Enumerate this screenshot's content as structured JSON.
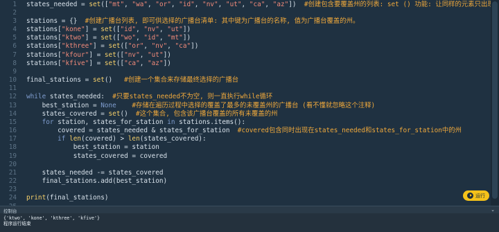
{
  "editor": {
    "lines": [
      {
        "n": "1",
        "segs": [
          [
            "pl",
            "states_needed = "
          ],
          [
            "fn",
            "set"
          ],
          [
            "pl",
            "(["
          ],
          [
            "str",
            "\"mt\""
          ],
          [
            "pl",
            ", "
          ],
          [
            "str",
            "\"wa\""
          ],
          [
            "pl",
            ", "
          ],
          [
            "str",
            "\"or\""
          ],
          [
            "pl",
            ", "
          ],
          [
            "str",
            "\"id\""
          ],
          [
            "pl",
            ", "
          ],
          [
            "str",
            "\"nv\""
          ],
          [
            "pl",
            ", "
          ],
          [
            "str",
            "\"ut\""
          ],
          [
            "pl",
            ", "
          ],
          [
            "str",
            "\"ca\""
          ],
          [
            "pl",
            ", "
          ],
          [
            "str",
            "\"az\""
          ],
          [
            "pl",
            "])  "
          ],
          [
            "cm",
            "#创建包含要覆盖州的列表: set () 功能: 让同样的元素只出现一次。"
          ]
        ]
      },
      {
        "n": "2",
        "segs": []
      },
      {
        "n": "3",
        "segs": [
          [
            "pl",
            "stations = {}  "
          ],
          [
            "cm",
            "#创建广播台列表, 即可供选择的广播台清单: 其中键为广播台的名称, 值为广播台覆盖的州。"
          ]
        ]
      },
      {
        "n": "4",
        "segs": [
          [
            "pl",
            "stations["
          ],
          [
            "str",
            "\"kone\""
          ],
          [
            "pl",
            "] = "
          ],
          [
            "fn",
            "set"
          ],
          [
            "pl",
            "(["
          ],
          [
            "str",
            "\"id\""
          ],
          [
            "pl",
            ", "
          ],
          [
            "str",
            "\"nv\""
          ],
          [
            "pl",
            ", "
          ],
          [
            "str",
            "\"ut\""
          ],
          [
            "pl",
            "])"
          ]
        ]
      },
      {
        "n": "5",
        "segs": [
          [
            "pl",
            "stations["
          ],
          [
            "str",
            "\"ktwo\""
          ],
          [
            "pl",
            "] = "
          ],
          [
            "fn",
            "set"
          ],
          [
            "pl",
            "(["
          ],
          [
            "str",
            "\"wo\""
          ],
          [
            "pl",
            ", "
          ],
          [
            "str",
            "\"id\""
          ],
          [
            "pl",
            ", "
          ],
          [
            "str",
            "\"mt\""
          ],
          [
            "pl",
            "])"
          ]
        ]
      },
      {
        "n": "6",
        "segs": [
          [
            "pl",
            "stations["
          ],
          [
            "str",
            "\"kthree\""
          ],
          [
            "pl",
            "] = "
          ],
          [
            "fn",
            "set"
          ],
          [
            "pl",
            "(["
          ],
          [
            "str",
            "\"or\""
          ],
          [
            "pl",
            ", "
          ],
          [
            "str",
            "\"nv\""
          ],
          [
            "pl",
            ", "
          ],
          [
            "str",
            "\"ca\""
          ],
          [
            "pl",
            "])"
          ]
        ]
      },
      {
        "n": "7",
        "segs": [
          [
            "pl",
            "stations["
          ],
          [
            "str",
            "\"kfour\""
          ],
          [
            "pl",
            "] = "
          ],
          [
            "fn",
            "set"
          ],
          [
            "pl",
            "(["
          ],
          [
            "str",
            "\"nv\""
          ],
          [
            "pl",
            ", "
          ],
          [
            "str",
            "\"ut\""
          ],
          [
            "pl",
            "])"
          ]
        ]
      },
      {
        "n": "8",
        "segs": [
          [
            "pl",
            "stations["
          ],
          [
            "str",
            "\"kfive\""
          ],
          [
            "pl",
            "] = "
          ],
          [
            "fn",
            "set"
          ],
          [
            "pl",
            "(["
          ],
          [
            "str",
            "\"ca\""
          ],
          [
            "pl",
            ", "
          ],
          [
            "str",
            "\"az\""
          ],
          [
            "pl",
            "])"
          ]
        ]
      },
      {
        "n": "9",
        "segs": []
      },
      {
        "n": "10",
        "segs": [
          [
            "pl",
            "final_stations = "
          ],
          [
            "fn",
            "set"
          ],
          [
            "pl",
            "()   "
          ],
          [
            "cm",
            "#创建一个集合来存储最终选择的广播台"
          ]
        ]
      },
      {
        "n": "11",
        "segs": []
      },
      {
        "n": "12",
        "segs": [
          [
            "kw",
            "while"
          ],
          [
            "pl",
            " states_needed:  "
          ],
          [
            "cm",
            "#只要states_needed不为空, 则一直执行while循环"
          ]
        ]
      },
      {
        "n": "13",
        "segs": [
          [
            "pl",
            "    best_station = "
          ],
          [
            "kw",
            "None"
          ],
          [
            "pl",
            "    "
          ],
          [
            "cm",
            "#存储在遍历过程中选择的覆盖了最多的未覆盖州的广播台 (看不懂就忽略这个注释)"
          ]
        ]
      },
      {
        "n": "14",
        "segs": [
          [
            "pl",
            "    states_covered = "
          ],
          [
            "fn",
            "set"
          ],
          [
            "pl",
            "()  "
          ],
          [
            "cm",
            "#这个集合, 包含该广播台覆盖的所有未覆盖的州"
          ]
        ]
      },
      {
        "n": "15",
        "segs": [
          [
            "pl",
            "    "
          ],
          [
            "kw",
            "for"
          ],
          [
            "pl",
            " station, states_for_station "
          ],
          [
            "kw",
            "in"
          ],
          [
            "pl",
            " stations.items():"
          ]
        ]
      },
      {
        "n": "16",
        "segs": [
          [
            "pl",
            "        covered = states_needed & states_for_station  "
          ],
          [
            "cm",
            "#covered包含同时出现在states_needed和states_for_station中的州"
          ]
        ]
      },
      {
        "n": "17",
        "segs": [
          [
            "pl",
            "        "
          ],
          [
            "kw",
            "if"
          ],
          [
            "pl",
            " "
          ],
          [
            "fn",
            "len"
          ],
          [
            "pl",
            "(covered) > "
          ],
          [
            "fn",
            "len"
          ],
          [
            "pl",
            "(states_covered):"
          ]
        ]
      },
      {
        "n": "18",
        "segs": [
          [
            "pl",
            "            best_station = station"
          ]
        ]
      },
      {
        "n": "19",
        "segs": [
          [
            "pl",
            "            states_covered = covered"
          ]
        ]
      },
      {
        "n": "20",
        "segs": []
      },
      {
        "n": "21",
        "segs": [
          [
            "pl",
            "    states_needed -= states_covered"
          ]
        ]
      },
      {
        "n": "22",
        "segs": [
          [
            "pl",
            "    final_stations.add(best_station)"
          ]
        ]
      },
      {
        "n": "23",
        "segs": []
      },
      {
        "n": "24",
        "segs": [
          [
            "fn",
            "print"
          ],
          [
            "pl",
            "(final_stations)"
          ]
        ]
      },
      {
        "n": "25",
        "segs": []
      }
    ],
    "run_button_label": "运行"
  },
  "console": {
    "title": "控制台",
    "toggle_icon": "⌄",
    "output_lines": [
      "{'ktwo', 'kone', 'kthree', 'kfive'}",
      "程序运行结束"
    ]
  },
  "colors": {
    "background": "#1f3141",
    "keyword": "#7f9dcf",
    "function": "#f5cf6a",
    "string": "#f18a7a",
    "comment": "#f0a93c",
    "run_button": "#f4c21a"
  },
  "icons": {
    "run": "play-circle-icon",
    "console_toggle": "chevron-down-icon"
  }
}
